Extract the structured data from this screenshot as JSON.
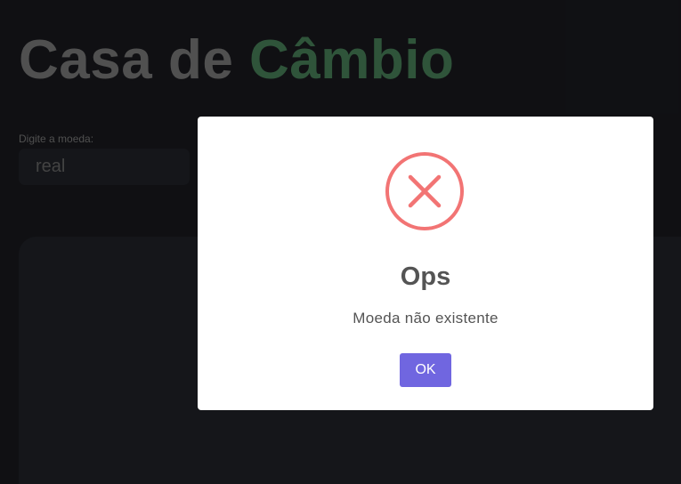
{
  "header": {
    "title_part1": "Casa de",
    "title_part2": "Câmbio"
  },
  "form": {
    "label": "Digite a moeda:",
    "value": "real"
  },
  "alert": {
    "icon": "error-x-icon",
    "title": "Ops",
    "message": "Moeda não existente",
    "confirm_label": "OK"
  },
  "colors": {
    "background": "#1b1c21",
    "panel": "#24262c",
    "title_gray": "#858585",
    "title_green": "#4f8d62",
    "error_red": "#f27474",
    "confirm_button": "#7066e0"
  }
}
